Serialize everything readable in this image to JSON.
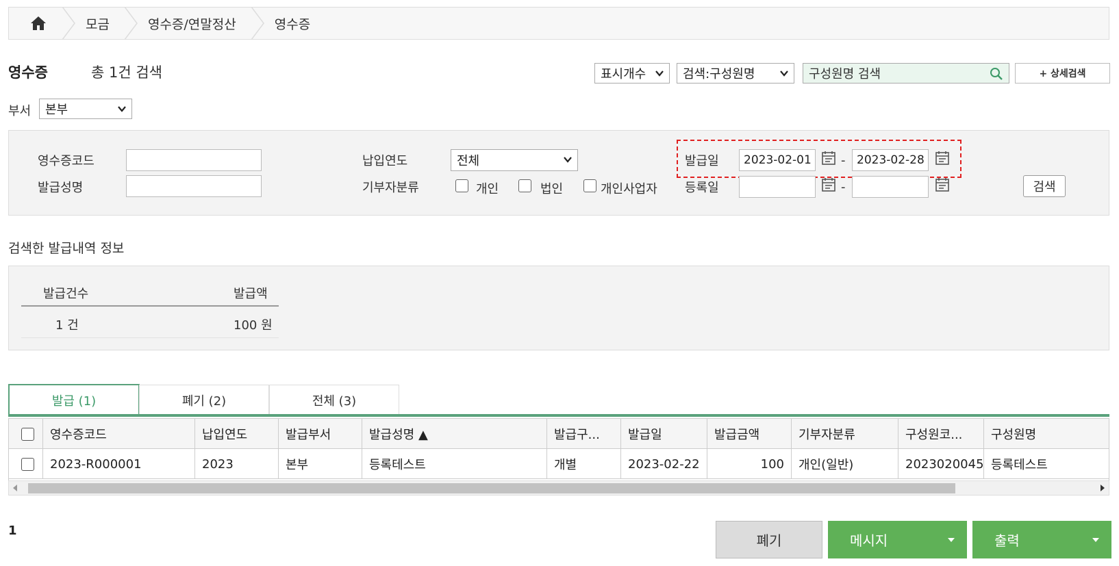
{
  "breadcrumb": {
    "items": [
      "모금",
      "영수증/연말정산",
      "영수증"
    ]
  },
  "header": {
    "title": "영수증",
    "result_count": "총 1건 검색"
  },
  "toolbar": {
    "display_count": "표시개수",
    "search_type": "검색:구성원명",
    "search_placeholder": "구성원명 검색",
    "advanced_search": "+ 상세검색"
  },
  "dept": {
    "label": "부서",
    "value": "본부"
  },
  "filters": {
    "receipt_code_label": "영수증코드",
    "issue_name_label": "발급성명",
    "pay_year_label": "납입연도",
    "pay_year_value": "전체",
    "donor_type_label": "기부자분류",
    "donor_types": [
      "개인",
      "법인",
      "개인사업자"
    ],
    "issue_date_label": "발급일",
    "issue_date_from": "2023-02-01",
    "issue_date_to": "2023-02-28",
    "reg_date_label": "등록일",
    "range_sep": "-",
    "search_button": "검색"
  },
  "summary": {
    "title": "검색한 발급내역 정보",
    "count_label": "발급건수",
    "amount_label": "발급액",
    "count_value": "1 건",
    "amount_value": "100 원"
  },
  "tabs": [
    {
      "label": "발급 (1)",
      "active": true
    },
    {
      "label": "폐기 (2)",
      "active": false
    },
    {
      "label": "전체 (3)",
      "active": false
    }
  ],
  "table": {
    "columns": [
      "영수증코드",
      "납입연도",
      "발급부서",
      "발급성명 ▲",
      "발급구...",
      "발급일",
      "발급금액",
      "기부자분류",
      "구성원코...",
      "구성원명"
    ],
    "rows": [
      [
        "2023-R000001",
        "2023",
        "본부",
        "등록테스트",
        "개별",
        "2023-02-22",
        "100",
        "개인(일반)",
        "2023020045",
        "등록테스트"
      ]
    ]
  },
  "footer": {
    "page": "1",
    "discard_button": "폐기",
    "message_button": "메시지",
    "print_button": "출력"
  },
  "colors": {
    "accent_green": "#5fb157",
    "tab_green": "#5aa27c",
    "highlight_red": "#e02020"
  }
}
